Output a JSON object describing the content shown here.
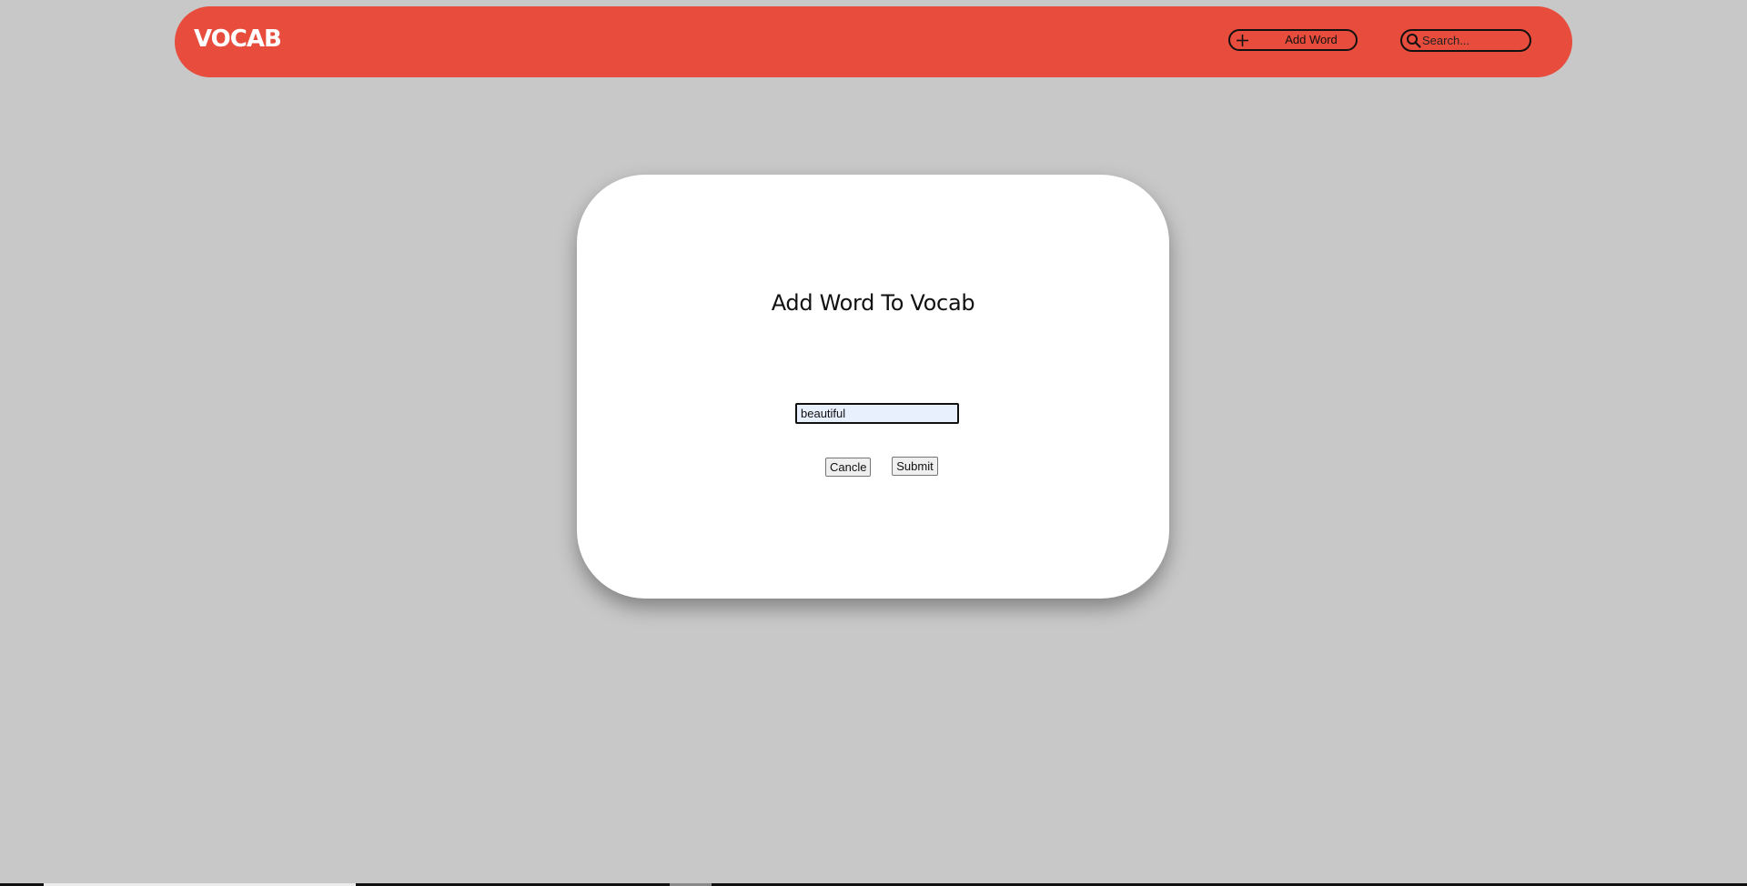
{
  "header": {
    "logo": "VOCAB",
    "add_word_label": "Add Word",
    "search_placeholder": "Search..."
  },
  "modal": {
    "title": "Add Word To Vocab",
    "word_input_value": "beautiful",
    "cancel_label": "Cancle",
    "submit_label": "Submit"
  },
  "colors": {
    "navbar": "#e74c3c",
    "page_background": "#c8c8c8",
    "modal_background": "#ffffff",
    "input_background": "#e8f0fe"
  },
  "icons": {
    "add": "plus-icon",
    "search": "search-icon"
  }
}
